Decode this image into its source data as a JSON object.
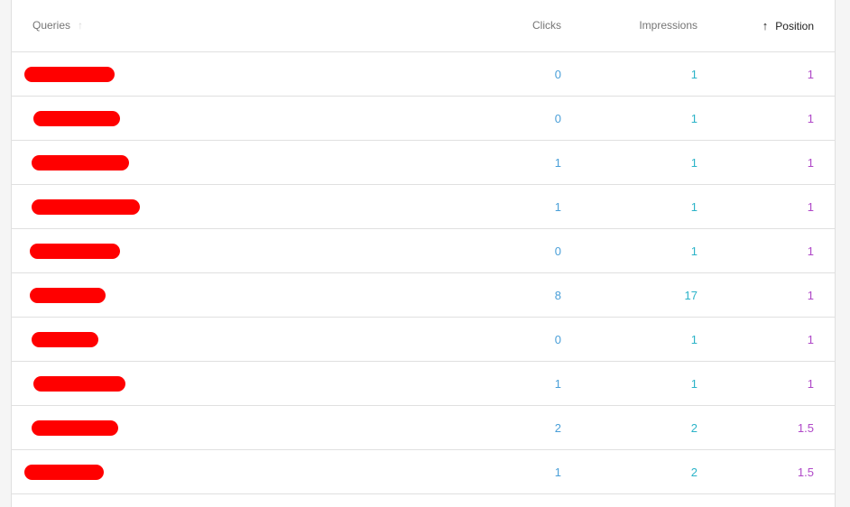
{
  "table": {
    "headers": {
      "queries": "Queries",
      "clicks": "Clicks",
      "impressions": "Impressions",
      "position": "Position"
    },
    "sort": {
      "column": "position",
      "direction": "ascending",
      "icon": "arrow-up-icon"
    },
    "colors": {
      "clicks": "#4a9fd8",
      "impressions": "#2bb3c8",
      "position": "#b048c8",
      "redaction": "#ff0000"
    },
    "rows": [
      {
        "query": "[redacted]",
        "clicks": "0",
        "impressions": "1",
        "position": "1"
      },
      {
        "query": "[redacted]",
        "clicks": "0",
        "impressions": "1",
        "position": "1"
      },
      {
        "query": "[redacted]",
        "clicks": "1",
        "impressions": "1",
        "position": "1"
      },
      {
        "query": "[redacted]",
        "clicks": "1",
        "impressions": "1",
        "position": "1"
      },
      {
        "query": "[redacted]",
        "clicks": "0",
        "impressions": "1",
        "position": "1"
      },
      {
        "query": "[redacted]",
        "clicks": "8",
        "impressions": "17",
        "position": "1"
      },
      {
        "query": "[redacted]",
        "clicks": "0",
        "impressions": "1",
        "position": "1"
      },
      {
        "query": "[redacted]",
        "clicks": "1",
        "impressions": "1",
        "position": "1"
      },
      {
        "query": "[redacted]",
        "clicks": "2",
        "impressions": "2",
        "position": "1.5"
      },
      {
        "query": "[redacted]",
        "clicks": "1",
        "impressions": "2",
        "position": "1.5"
      }
    ]
  }
}
